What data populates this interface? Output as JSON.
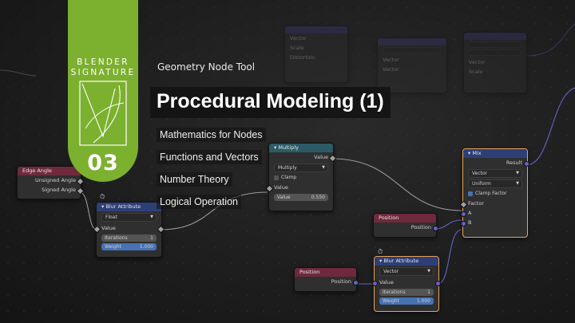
{
  "banner": {
    "brand_line1": "BLENDER",
    "brand_line2": "SIGNATURE",
    "episode_number": "03",
    "color": "#7cb02f"
  },
  "header": {
    "subtitle": "Geometry Node Tool",
    "title": "Procedural Modeling (1)"
  },
  "topics": [
    "Mathematics for Nodes",
    "Functions and Vectors",
    "Number Theory",
    "Logical Operation"
  ],
  "nodes": {
    "edge_angle": {
      "title": "Edge Angle",
      "outputs": [
        "Unsigned Angle",
        "Signed Angle"
      ]
    },
    "blur_left": {
      "title": "Blur Attribute",
      "type": "Float",
      "input_value": "Value",
      "output_value": "Value",
      "iterations_label": "Iterations",
      "iterations": "1",
      "weight_label": "Weight",
      "weight": "1.000"
    },
    "multiply": {
      "title": "Multiply",
      "output": "Value",
      "operation": "Multiply",
      "clamp_label": "Clamp",
      "value_label": "Value",
      "field_label": "Value",
      "field_value": "0.550"
    },
    "position_mid": {
      "title": "Position",
      "output": "Position"
    },
    "position_bottom": {
      "title": "Position",
      "output": "Position"
    },
    "blur_bottom": {
      "title": "Blur Attribute",
      "type": "Vector",
      "input_value": "Value",
      "iterations_label": "Iterations",
      "iterations": "1",
      "weight_label": "Weight",
      "weight": "1.000"
    },
    "mix": {
      "title": "Mix",
      "output": "Result",
      "data_type": "Vector",
      "mode": "Uniform",
      "clamp_label": "Clamp Factor",
      "factor_label": "Factor",
      "a_label": "A",
      "b_label": "B"
    }
  },
  "background_nodes": {
    "bg1": {
      "rows": [
        "Vector",
        "Scale",
        "Distortion"
      ]
    },
    "bg2": {
      "rows": [
        "Vector",
        "Vector"
      ]
    },
    "bg3": {
      "rows": [
        "Vector",
        "Scale"
      ]
    }
  },
  "colors": {
    "node_bg": "#2f2f2f",
    "input_header": "#6e2a3c",
    "math_header": "#2c5b66",
    "blur_header": "#2e3f77",
    "selected_outline": "#e8a35b",
    "field_blue": "#4772b3"
  }
}
